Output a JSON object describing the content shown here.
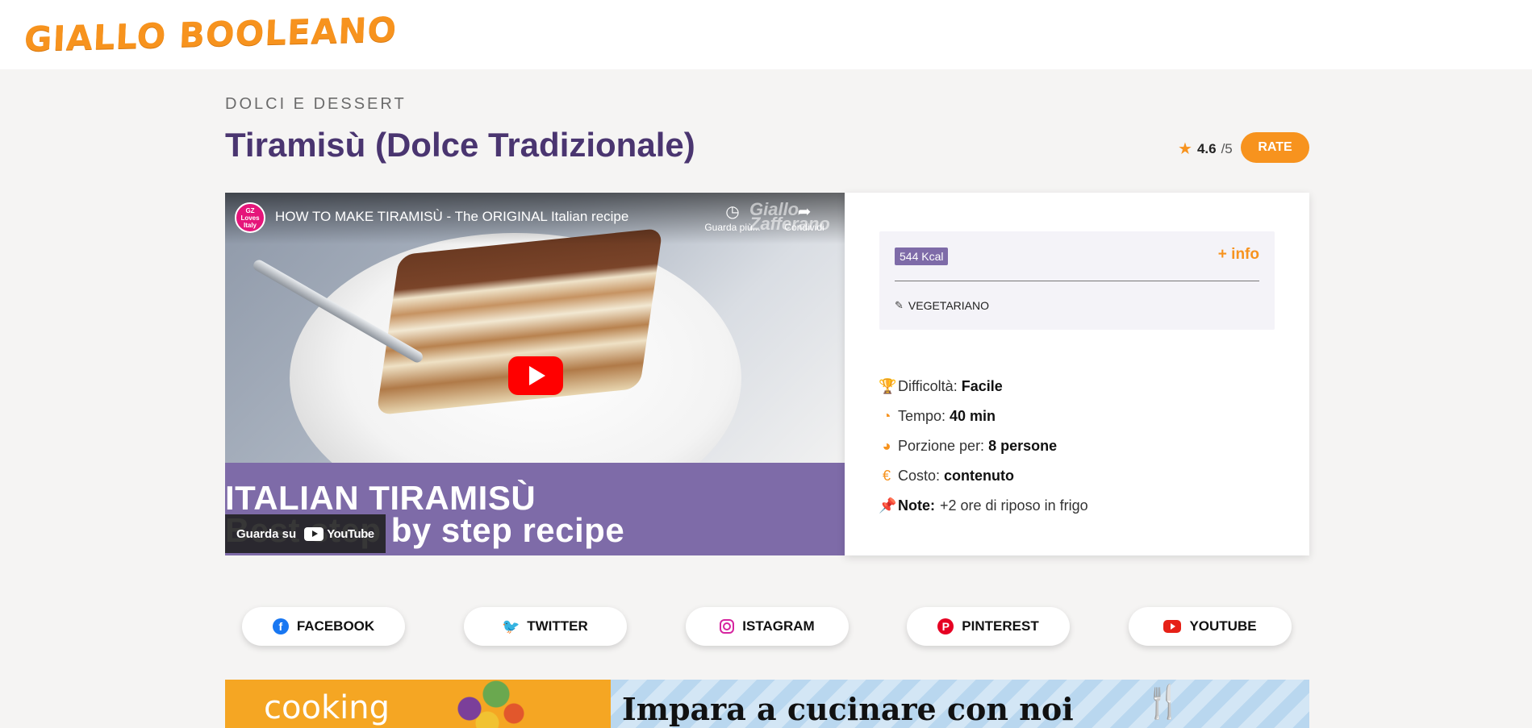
{
  "brand": {
    "logo_text": "GIALLO BOOLEANO",
    "accent_color": "#f7931e",
    "title_color": "#4a3570",
    "purple": "#7e6ba8"
  },
  "recipe": {
    "category": "DOLCI E DESSERT",
    "title": "Tiramisù (Dolce Tradizionale)",
    "rating": {
      "icon": "star-icon",
      "score": "4.6",
      "out_of": "/5",
      "rate_label": "RATE"
    }
  },
  "video": {
    "channel_avatar_text": "GZ Loves Italy",
    "title": "HOW TO MAKE TIRAMISÙ - The ORIGINAL Italian recipe",
    "watch_later_label": "Guarda più...",
    "share_label": "Condividi",
    "watermark": "Giallo Zafferano",
    "band_line1": "ITALIAN TIRAMISÙ",
    "band_line2": "Best step by step recipe",
    "watch_on_label": "Guarda su",
    "youtube_label": "YouTube"
  },
  "info": {
    "kcal": "544 Kcal",
    "more_info": "+ info",
    "diet_tag": "VEGETARIANO",
    "facts": [
      {
        "icon": "trophy-icon",
        "label": "Difficoltà:",
        "value": "Facile"
      },
      {
        "icon": "clock-icon",
        "label": "Tempo:",
        "value": "40 min"
      },
      {
        "icon": "pie-chart-icon",
        "label": "Porzione per:",
        "value": "8 persone"
      },
      {
        "icon": "euro-icon",
        "label": "Costo:",
        "value": "contenuto"
      },
      {
        "icon": "pin-icon",
        "label": "Note:",
        "value": "+2 ore di riposo in frigo"
      }
    ]
  },
  "social": [
    {
      "name": "facebook",
      "label": "FACEBOOK",
      "icon": "facebook-icon"
    },
    {
      "name": "twitter",
      "label": "TWITTER",
      "icon": "twitter-icon"
    },
    {
      "name": "instagram",
      "label": "ISTAGRAM",
      "icon": "instagram-icon"
    },
    {
      "name": "pinterest",
      "label": "PINTEREST",
      "icon": "pinterest-icon"
    },
    {
      "name": "youtube",
      "label": "YOUTUBE",
      "icon": "youtube-icon"
    }
  ],
  "banner": {
    "left_text": "cooking",
    "right_text": "Impara a cucinare con noi"
  }
}
